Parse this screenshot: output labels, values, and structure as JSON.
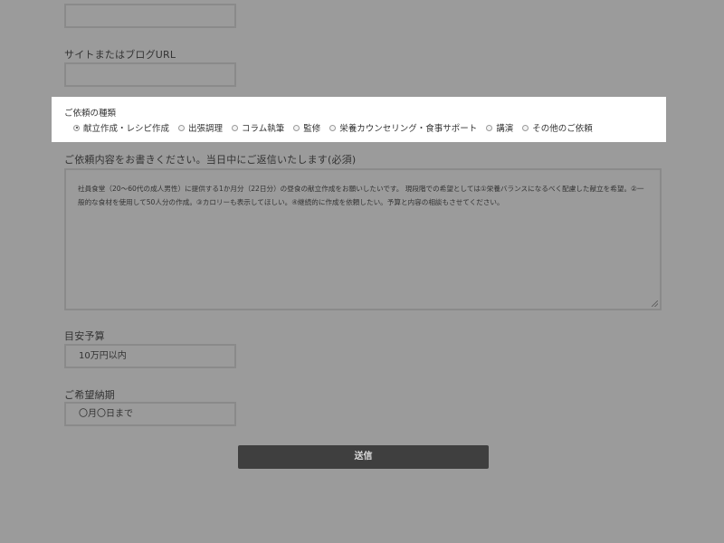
{
  "form": {
    "url_label": "サイトまたはブログURL",
    "request_type": {
      "label": "ご依頼の種類",
      "options": [
        "献立作成・レシピ作成",
        "出張調理",
        "コラム執筆",
        "監修",
        "栄養カウンセリング・食事サポート",
        "講演",
        "その他のご依頼"
      ],
      "selected_index": 0
    },
    "details_label": "ご依頼内容をお書きください。当日中にご返信いたします(必須)",
    "details_text": "社員食堂（20〜60代の成人男性）に提供する1か月分（22日分）の昼食の献立作成をお願いしたいです。 現段階での希望としては①栄養バランスになるべく配慮した献立を希望。②一般的な食材を使用して50人分の作成。③カロリーも表示してほしい。④継続的に作成を依頼したい。予算と内容の相談もさせてください。",
    "budget_label": "目安予算",
    "budget_value": "10万円以内",
    "deadline_label": "ご希望納期",
    "deadline_value": "〇月〇日まで",
    "submit_label": "送信"
  }
}
